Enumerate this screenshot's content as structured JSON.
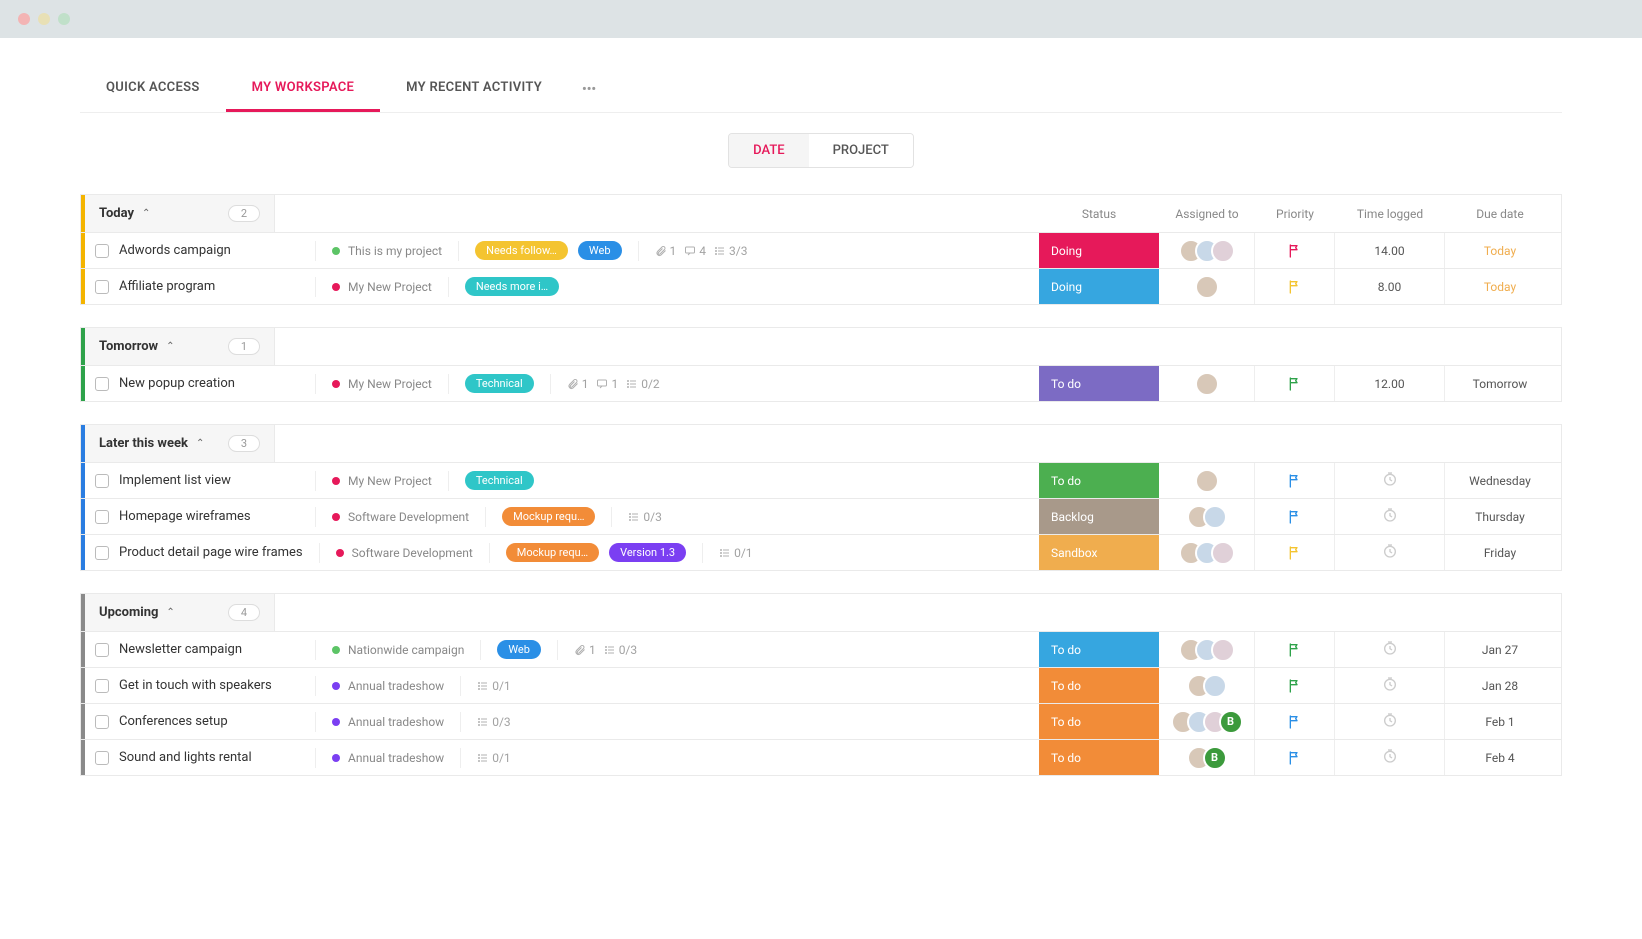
{
  "nav": {
    "tabs": [
      "QUICK ACCESS",
      "MY WORKSPACE",
      "MY RECENT ACTIVITY"
    ],
    "active_index": 1,
    "more": "•••"
  },
  "view_toggle": {
    "options": [
      "DATE",
      "PROJECT"
    ],
    "active_index": 0
  },
  "columns": {
    "status": "Status",
    "assigned": "Assigned to",
    "priority": "Priority",
    "time": "Time logged",
    "due": "Due date"
  },
  "colors": {
    "stripe_today": "#f4b400",
    "stripe_tomorrow": "#2ea24a",
    "stripe_later": "#2a7de1",
    "stripe_upcoming": "#8a8a8a",
    "status_doing_pink": "#e6195a",
    "status_doing_blue": "#36a6e0",
    "status_todo_purple": "#7c6bc4",
    "status_todo_green": "#4caf50",
    "status_backlog": "#a8998a",
    "status_sandbox": "#f0ad4e",
    "status_todo_blue": "#36a6e0",
    "status_todo_orange": "#f28c38",
    "badge_yellow": "#f4c430",
    "badge_blue": "#2a8fe6",
    "badge_teal": "#2fc6c8",
    "badge_orange": "#f28c38",
    "badge_purple": "#7b3ff2",
    "proj_green": "#5cc466",
    "proj_pink": "#e6195a",
    "proj_purple": "#7b3ff2",
    "flag_red": "#e6195a",
    "flag_yellow": "#f4c430",
    "flag_green": "#2ea24a",
    "flag_blue": "#2a8fe6"
  },
  "sections": [
    {
      "title": "Today",
      "count": "2",
      "stripe": "stripe_today",
      "tasks": [
        {
          "name": "Adwords campaign",
          "project": {
            "dot": "proj_green",
            "name": "This is my project"
          },
          "badges": [
            {
              "text": "Needs follow…",
              "color": "badge_yellow"
            },
            {
              "text": "Web",
              "color": "badge_blue"
            }
          ],
          "meta": {
            "attachments": "1",
            "comments": "4",
            "subtasks": "3/3"
          },
          "status": {
            "text": "Doing",
            "color": "status_doing_pink"
          },
          "avatars": 3,
          "extra_avatar": null,
          "priority": "flag_red",
          "time": "14.00",
          "due": "Today",
          "due_color": "#f0ad4e"
        },
        {
          "name": "Affiliate program",
          "project": {
            "dot": "proj_pink",
            "name": "My New Project"
          },
          "badges": [
            {
              "text": "Needs more i…",
              "color": "badge_teal"
            }
          ],
          "meta": {},
          "status": {
            "text": "Doing",
            "color": "status_doing_blue"
          },
          "avatars": 1,
          "extra_avatar": null,
          "priority": "flag_yellow",
          "time": "8.00",
          "due": "Today",
          "due_color": "#f0ad4e"
        }
      ]
    },
    {
      "title": "Tomorrow",
      "count": "1",
      "stripe": "stripe_tomorrow",
      "tasks": [
        {
          "name": "New popup creation",
          "project": {
            "dot": "proj_pink",
            "name": "My New Project"
          },
          "badges": [
            {
              "text": "Technical",
              "color": "badge_teal"
            }
          ],
          "meta": {
            "attachments": "1",
            "comments": "1",
            "subtasks": "0/2"
          },
          "status": {
            "text": "To do",
            "color": "status_todo_purple"
          },
          "avatars": 1,
          "extra_avatar": null,
          "priority": "flag_green",
          "time": "12.00",
          "due": "Tomorrow",
          "due_color": "#555"
        }
      ]
    },
    {
      "title": "Later this week",
      "count": "3",
      "stripe": "stripe_later",
      "tasks": [
        {
          "name": "Implement list view",
          "project": {
            "dot": "proj_pink",
            "name": "My New Project"
          },
          "badges": [
            {
              "text": "Technical",
              "color": "badge_teal"
            }
          ],
          "meta": {},
          "status": {
            "text": "To do",
            "color": "status_todo_green"
          },
          "avatars": 1,
          "extra_avatar": null,
          "priority": "flag_blue",
          "time_clock": true,
          "due": "Wednesday",
          "due_color": "#555"
        },
        {
          "name": "Homepage wireframes",
          "project": {
            "dot": "proj_pink",
            "name": "Software Development"
          },
          "badges": [
            {
              "text": "Mockup requ…",
              "color": "badge_orange"
            }
          ],
          "meta": {
            "subtasks": "0/3"
          },
          "status": {
            "text": "Backlog",
            "color": "status_backlog"
          },
          "avatars": 2,
          "extra_avatar": null,
          "priority": "flag_blue",
          "time_clock": true,
          "due": "Thursday",
          "due_color": "#555"
        },
        {
          "name": "Product detail page wire frames",
          "project": {
            "dot": "proj_pink",
            "name": "Software Development"
          },
          "badges": [
            {
              "text": "Mockup requ…",
              "color": "badge_orange"
            },
            {
              "text": "Version 1.3",
              "color": "badge_purple"
            }
          ],
          "meta": {
            "subtasks": "0/1"
          },
          "status": {
            "text": "Sandbox",
            "color": "status_sandbox"
          },
          "avatars": 3,
          "extra_avatar": null,
          "priority": "flag_yellow",
          "time_clock": true,
          "due": "Friday",
          "due_color": "#555"
        }
      ]
    },
    {
      "title": "Upcoming",
      "count": "4",
      "stripe": "stripe_upcoming",
      "tasks": [
        {
          "name": "Newsletter campaign",
          "project": {
            "dot": "proj_green",
            "name": "Nationwide campaign"
          },
          "badges": [
            {
              "text": "Web",
              "color": "badge_blue"
            }
          ],
          "meta": {
            "attachments": "1",
            "subtasks": "0/3"
          },
          "status": {
            "text": "To do",
            "color": "status_todo_blue"
          },
          "avatars": 3,
          "extra_avatar": null,
          "priority": "flag_green",
          "time_clock": true,
          "due": "Jan 27",
          "due_color": "#555"
        },
        {
          "name": "Get in touch with speakers",
          "project": {
            "dot": "proj_purple",
            "name": "Annual tradeshow"
          },
          "badges": [],
          "meta": {
            "subtasks": "0/1"
          },
          "status": {
            "text": "To do",
            "color": "status_todo_orange"
          },
          "avatars": 2,
          "extra_avatar": null,
          "priority": "flag_green",
          "time_clock": true,
          "due": "Jan 28",
          "due_color": "#555"
        },
        {
          "name": "Conferences setup",
          "project": {
            "dot": "proj_purple",
            "name": "Annual tradeshow"
          },
          "badges": [],
          "meta": {
            "subtasks": "0/3"
          },
          "status": {
            "text": "To do",
            "color": "status_todo_orange"
          },
          "avatars": 3,
          "extra_avatar": "B",
          "priority": "flag_blue",
          "time_clock": true,
          "due": "Feb 1",
          "due_color": "#555"
        },
        {
          "name": "Sound and lights rental",
          "project": {
            "dot": "proj_purple",
            "name": "Annual tradeshow"
          },
          "badges": [],
          "meta": {
            "subtasks": "0/1"
          },
          "status": {
            "text": "To do",
            "color": "status_todo_orange"
          },
          "avatars": 1,
          "extra_avatar": "B",
          "priority": "flag_blue",
          "time_clock": true,
          "due": "Feb 4",
          "due_color": "#555"
        }
      ]
    }
  ]
}
